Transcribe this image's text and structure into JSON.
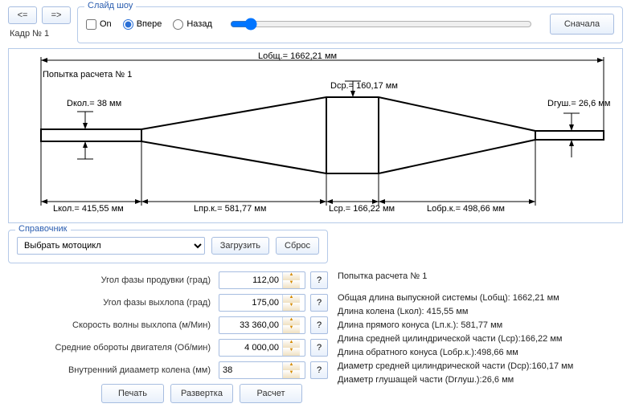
{
  "nav": {
    "prev": "<=",
    "next": "=>",
    "frame": "Кадр № 1"
  },
  "slideshow": {
    "legend": "Слайд шоу",
    "on": "On",
    "fwd": "Впере",
    "back": "Назад",
    "restart": "Сначала"
  },
  "diagram": {
    "attempt": "Попытка расчета № 1",
    "lobsh": "Lобщ.= 1662,21 мм",
    "dkol": "Dкол.= 38 мм",
    "dcp": "Dср.= 160,17 мм",
    "dgush": "Dгуш.= 26,6 мм",
    "lkol": "Lкол.= 415,55 мм",
    "lprk": "Lпр.к.= 581,77 мм",
    "lcp": "Lср.= 166,22 мм",
    "lobrk": "Lобр.к.= 498,66 мм"
  },
  "sprav": {
    "legend": "Справочник",
    "select_placeholder": "Выбрать мотоцикл",
    "load": "Загрузить",
    "reset": "Сброс"
  },
  "params": {
    "p1_label": "Угол фазы продувки (град)",
    "p1_val": "112,00",
    "p2_label": "Угол фазы выхлопа (град)",
    "p2_val": "175,00",
    "p3_label": "Скорость волны выхлопа (м/Мин)",
    "p3_val": "33 360,00",
    "p4_label": "Средние обороты двигателя (Об/мин)",
    "p4_val": "4 000,00",
    "p5_label": "Внутренний диааметр колена (мм)",
    "p5_val": "38",
    "q": "?"
  },
  "actions": {
    "print": "Печать",
    "unfold": "Развертка",
    "calc": "Расчет"
  },
  "results": {
    "l0": "Попытка расчета № 1",
    "l1": "Общая длина выпускной системы (Lобщ): 1662,21 мм",
    "l2": "Длина колена (Lкол): 415,55 мм",
    "l3": "Длина прямого конуса (Lп.к.): 581,77 мм",
    "l4": "Длина средней цилиндрической части (Lср):166,22 мм",
    "l5": "Длина обратного конуса (Lобр.к.):498,66 мм",
    "l6": "Диаметр средней цилиндрической части (Dср):160,17 мм",
    "l7": "Диаметр глушащей части (Dглуш.):26,6 мм"
  },
  "chart_data": {
    "type": "diagram",
    "title": "Попытка расчета № 1",
    "total_length_mm": 1662.21,
    "segments": [
      {
        "name": "Lкол",
        "length_mm": 415.55
      },
      {
        "name": "Lпр.к.",
        "length_mm": 581.77
      },
      {
        "name": "Lср",
        "length_mm": 166.22
      },
      {
        "name": "Lобр.к.",
        "length_mm": 498.66
      }
    ],
    "diameters": {
      "Dкол_mm": 38,
      "Dср_mm": 160.17,
      "Dгуш_mm": 26.6
    }
  }
}
